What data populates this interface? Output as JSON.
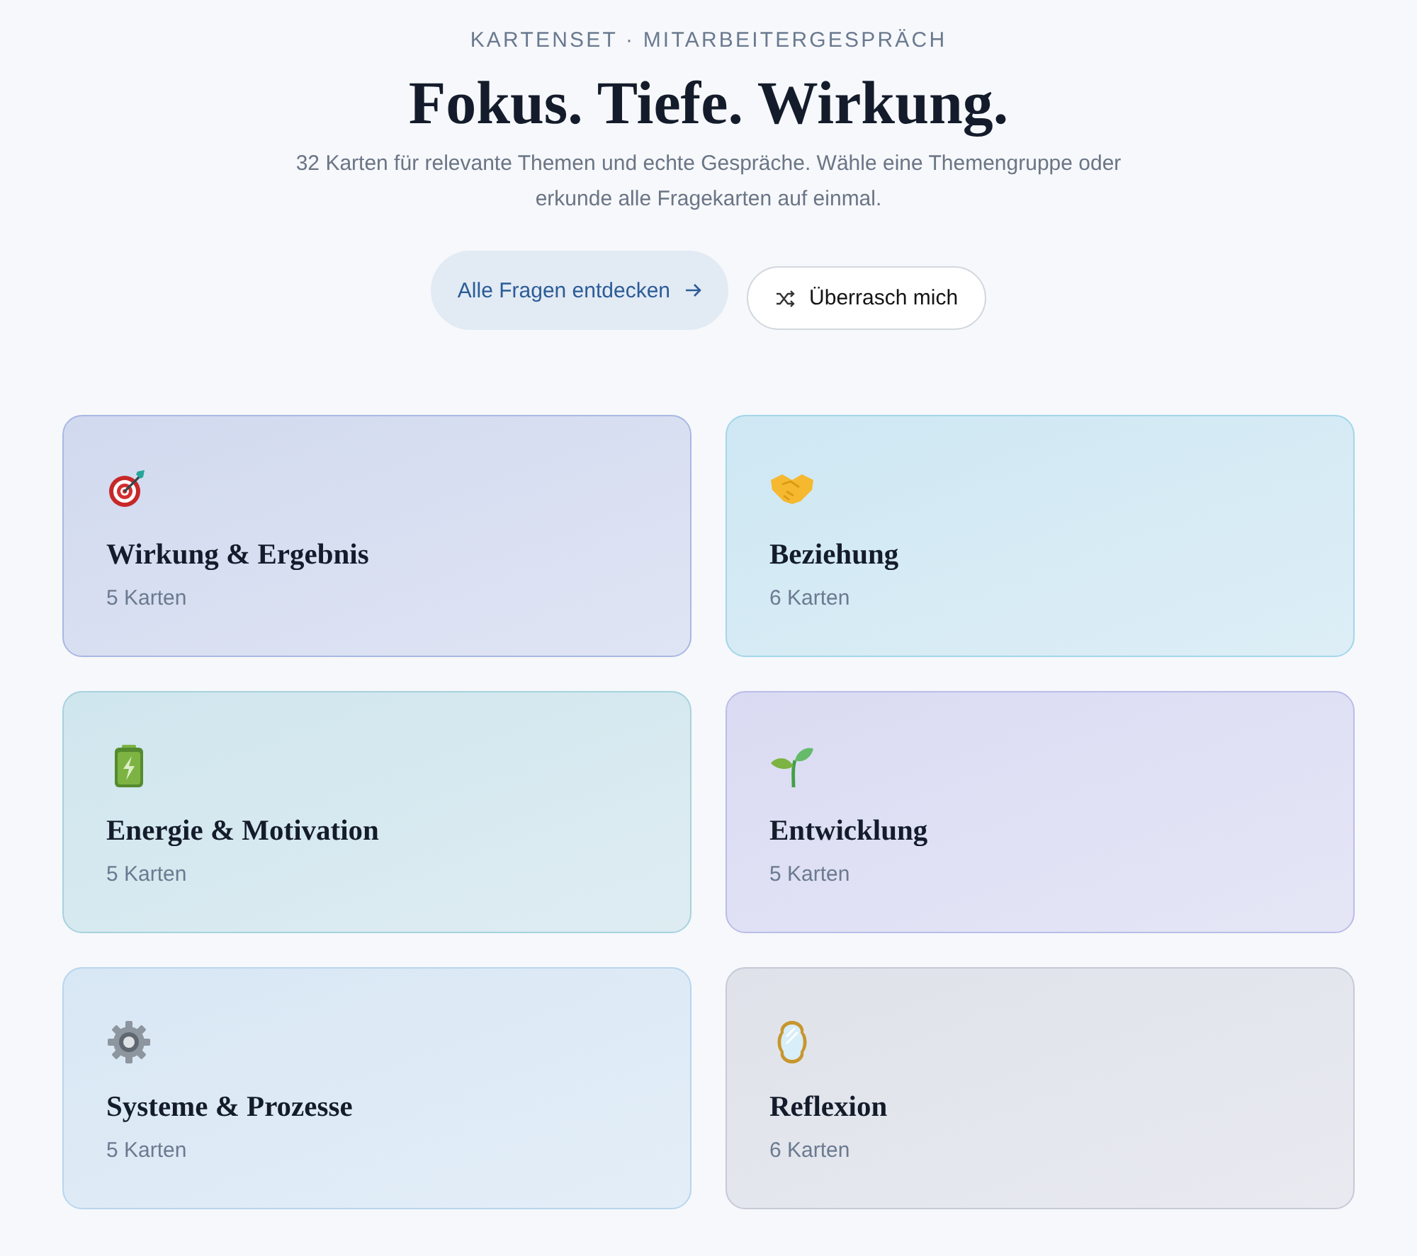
{
  "header": {
    "eyebrow": "KARTENSET · MITARBEITERGESPRÄCH",
    "title": "Fokus. Tiefe. Wirkung.",
    "subtitle": "32 Karten für relevante Themen und echte Gespräche. Wähle eine Themengruppe oder erkunde alle Fragekarten auf einmal."
  },
  "actions": [
    {
      "label": "Alle Fragen entdecken",
      "kind": "primary"
    },
    {
      "label": "Überrasch mich",
      "kind": "secondary"
    }
  ],
  "groups": [
    {
      "title": "Wirkung & Ergebnis",
      "count": "5 Karten",
      "color": "#a9b8e2"
    },
    {
      "title": "Beziehung",
      "count": "6 Karten",
      "color": "#a3d6ea"
    },
    {
      "title": "Energie & Motivation",
      "count": "5 Karten",
      "color": "#a6d2de"
    },
    {
      "title": "Entwicklung",
      "count": "5 Karten",
      "color": "#bcbce9"
    },
    {
      "title": "Systeme & Prozesse",
      "count": "5 Karten",
      "color": "#b8d5ee"
    },
    {
      "title": "Reflexion",
      "count": "6 Karten",
      "color": "#c6cad6"
    }
  ]
}
